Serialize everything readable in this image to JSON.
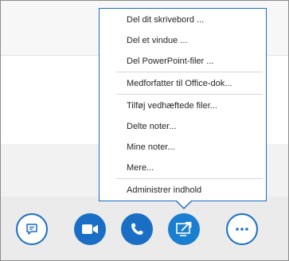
{
  "share_menu": {
    "items": [
      "Del dit skrivebord ...",
      "Del et vindue ...",
      "Del PowerPoint-filer ...",
      "Medforfatter til Office-dok...",
      "Tilføj vedhæftede filer...",
      "Delte noter...",
      "Mine noter...",
      "Mere...",
      "Administrer indhold"
    ]
  },
  "toolbar": {
    "buttons": [
      {
        "icon": "chat-icon",
        "style": "outline"
      },
      {
        "icon": "video-camera-icon",
        "style": "filled"
      },
      {
        "icon": "phone-icon",
        "style": "filled"
      },
      {
        "icon": "present-screen-icon",
        "style": "filled",
        "active": true
      },
      {
        "icon": "more-options-icon",
        "style": "outline"
      }
    ]
  },
  "colors": {
    "accent": "#1a6fc4",
    "toolbar_bg": "#ebebeb",
    "menu_border": "#1a6fc4",
    "separator": "#d6d6d6",
    "text": "#262626"
  }
}
